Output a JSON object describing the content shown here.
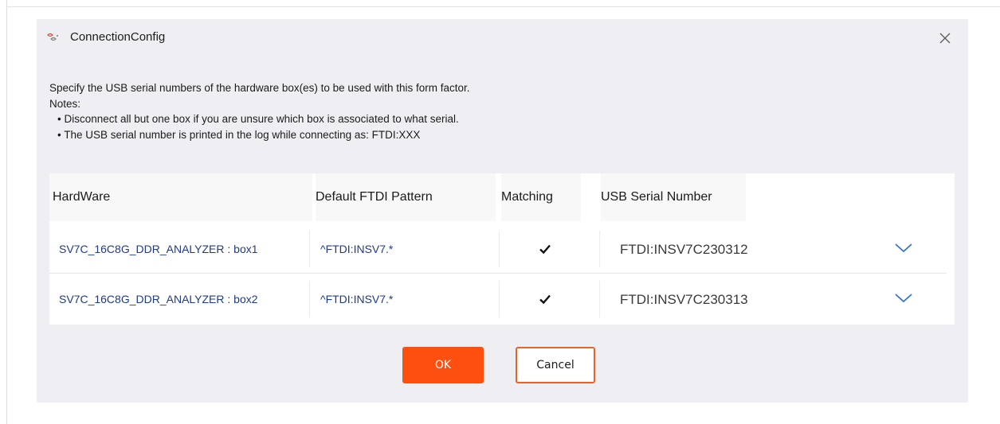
{
  "window": {
    "title": "ConnectionConfig",
    "accent_color": "#fc4f10"
  },
  "description": {
    "intro": "Specify the USB serial numbers of the hardware box(es) to be used with this form factor.",
    "notes_label": "Notes:",
    "bullets": [
      "• Disconnect all but one box if you are unsure which box is associated to what serial.",
      "• The USB serial number is printed in the log while connecting as: FTDI:XXX"
    ]
  },
  "table": {
    "headers": {
      "hardware": "HardWare",
      "pattern": "Default FTDI Pattern",
      "matching": "Matching",
      "serial": "USB Serial Number"
    },
    "rows": [
      {
        "hardware": "SV7C_16C8G_DDR_ANALYZER : box1",
        "pattern": "^FTDI:INSV7.*",
        "matching": true,
        "serial": "FTDI:INSV7C230312"
      },
      {
        "hardware": "SV7C_16C8G_DDR_ANALYZER : box2",
        "pattern": "^FTDI:INSV7.*",
        "matching": true,
        "serial": "FTDI:INSV7C230313"
      }
    ]
  },
  "buttons": {
    "ok": "OK",
    "cancel": "Cancel"
  },
  "icons": {
    "app": "app-logo-icon",
    "close": "close-icon",
    "check": "checkmark-icon",
    "dropdown": "chevron-down-icon"
  }
}
